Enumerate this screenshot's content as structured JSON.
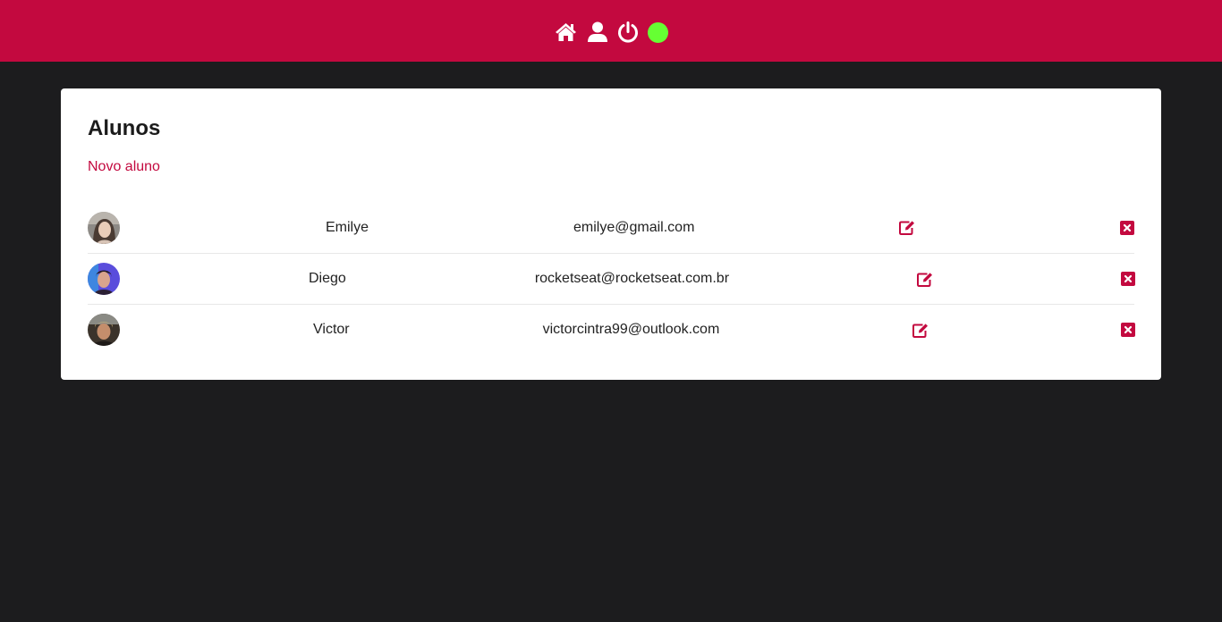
{
  "colors": {
    "brand": "#c3093f",
    "background": "#1c1c1e",
    "card": "#ffffff",
    "status_online": "#66ff33"
  },
  "header": {
    "icons": [
      "home-icon",
      "user-icon",
      "power-icon"
    ],
    "status": "online"
  },
  "page": {
    "title": "Alunos",
    "new_student_link": "Novo aluno"
  },
  "students": [
    {
      "name": "Emilye",
      "email": "emilye@gmail.com",
      "avatar": "avatar-photo"
    },
    {
      "name": "Diego",
      "email": "rocketseat@rocketseat.com.br",
      "avatar": "avatar-photo"
    },
    {
      "name": "Victor",
      "email": "victorcintra99@outlook.com",
      "avatar": "avatar-photo"
    }
  ],
  "row_actions": [
    "edit-icon",
    "delete-icon"
  ]
}
